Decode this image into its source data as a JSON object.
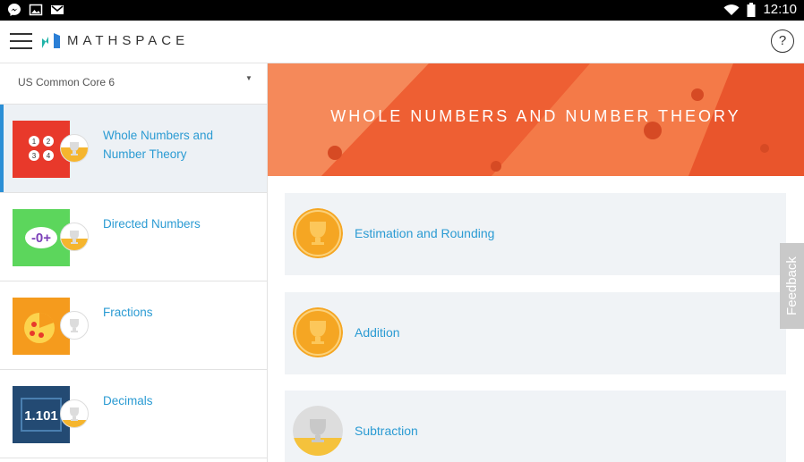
{
  "status_bar": {
    "time": "12:10"
  },
  "app": {
    "brand": "MATHSPACE",
    "help_label": "?"
  },
  "sidebar": {
    "course": "US Common Core 6",
    "topics": [
      {
        "title": "Whole Numbers and Number Theory",
        "active": true
      },
      {
        "title": "Directed Numbers"
      },
      {
        "title": "Fractions"
      },
      {
        "title": "Decimals"
      }
    ]
  },
  "main": {
    "banner_title": "WHOLE NUMBERS AND NUMBER THEORY",
    "skills": [
      {
        "title": "Estimation and Rounding"
      },
      {
        "title": "Addition"
      },
      {
        "title": "Subtraction"
      }
    ]
  },
  "feedback_label": "Feedback",
  "colors": {
    "accent_blue": "#2b9bd3",
    "trophy_orange": "#f5a623",
    "banner_orange": "#f26b3a"
  }
}
